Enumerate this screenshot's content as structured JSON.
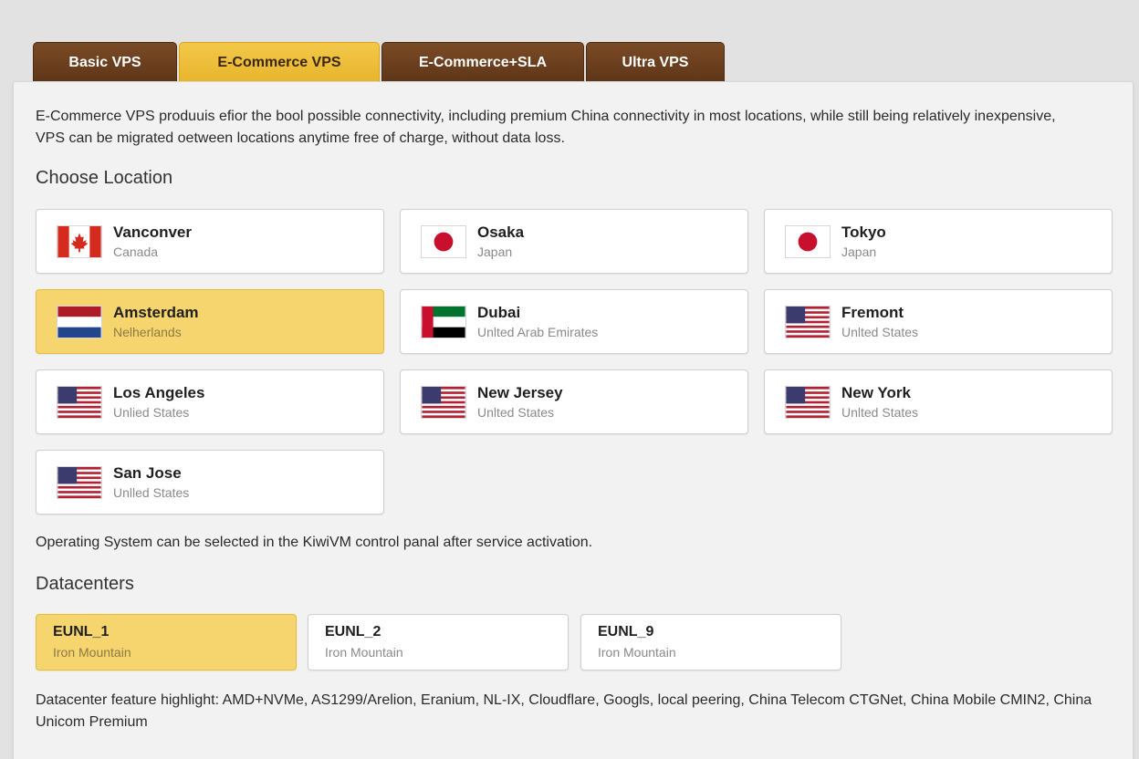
{
  "tabs": [
    {
      "label": "Basic VPS",
      "active": false
    },
    {
      "label": "E-Commerce VPS",
      "active": true
    },
    {
      "label": "E-Commerce+SLA",
      "active": false
    },
    {
      "label": "Ultra VPS",
      "active": false
    }
  ],
  "intro": "E-Commerce VPS produuis efior the bool possible connectivity, including premium China connectivity in most locations, while still being relatively inexpensive, VPS can be migrated oetween locations anytime free of charge, without data loss.",
  "choose_location_heading": "Choose Location",
  "locations": [
    {
      "city": "Vanconver",
      "country": "Canada",
      "flag": "canada-flag",
      "selected": false
    },
    {
      "city": "Osaka",
      "country": "Japan",
      "flag": "japan-flag",
      "selected": false
    },
    {
      "city": "Tokyo",
      "country": "Japan",
      "flag": "japan-flag",
      "selected": false
    },
    {
      "city": "Amsterdam",
      "country": "Nelherlands",
      "flag": "netherlands-flag",
      "selected": true
    },
    {
      "city": "Dubai",
      "country": "Unlted Arab Emirates",
      "flag": "uae-flag",
      "selected": false
    },
    {
      "city": "Fremont",
      "country": "Unlted States",
      "flag": "us-flag",
      "selected": false
    },
    {
      "city": "Los Angeles",
      "country": "Unlied States",
      "flag": "us-flag",
      "selected": false
    },
    {
      "city": "New Jersey",
      "country": "Unlted States",
      "flag": "us-flag",
      "selected": false
    },
    {
      "city": "New York",
      "country": "Unlted States",
      "flag": "us-flag",
      "selected": false
    },
    {
      "city": "San Jose",
      "country": "Unlled States",
      "flag": "us-flag",
      "selected": false
    }
  ],
  "os_note": "Operating System can be selected in the KiwiVM control panal after service activation.",
  "datacenters_heading": "Datacenters",
  "datacenters": [
    {
      "name": "EUNL_1",
      "sub": "Iron Mountain",
      "selected": true
    },
    {
      "name": "EUNL_2",
      "sub": "Iron Mountain",
      "selected": false
    },
    {
      "name": "EUNL_9",
      "sub": "Iron Mountain",
      "selected": false
    }
  ],
  "datacenter_highlight": "Datacenter feature highlight: AMD+NVMe, AS1299/Arelion, Eranium, NL-IX, Cloudflare, Googls, local peering, China Telecom CTGNet, China Mobile CMIN2, China Unicom Premium",
  "colors": {
    "tab_brown": "#6b4020",
    "tab_active": "#f0c13e",
    "selected_card": "#f6d56e"
  }
}
